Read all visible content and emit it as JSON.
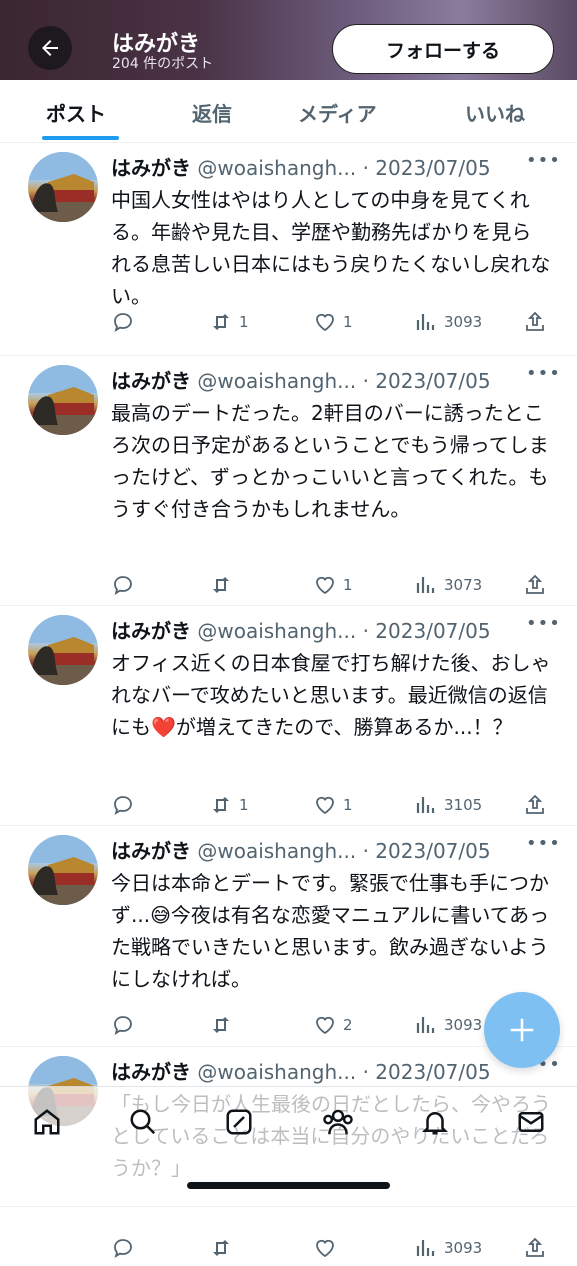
{
  "header": {
    "back_icon": "arrow-left-icon",
    "name": "はみがき",
    "post_count": "204 件のポスト",
    "follow_label": "フォローする"
  },
  "tabs": [
    "ポスト",
    "返信",
    "メディア",
    "いいね"
  ],
  "active_tab": 0,
  "posts": [
    {
      "name": "はみがき",
      "handle_date": "@woaishangh... · 2023/07/05",
      "text": "中国人女性はやはり人としての中身を見てくれる。年齢や見た目、学歴や勤務先ばかりを見られる息苦しい日本にはもう戻りたくないし戻れない。",
      "replies": "",
      "reposts": "1",
      "likes": "1",
      "views": "3093"
    },
    {
      "name": "はみがき",
      "handle_date": "@woaishangh... · 2023/07/05",
      "text": "最高のデートだった。2軒目のバーに誘ったところ次の日予定があるということでもう帰ってしまったけど、ずっとかっこいいと言ってくれた。もうすぐ付き合うかもしれません。",
      "replies": "",
      "reposts": "",
      "likes": "1",
      "views": "3073"
    },
    {
      "name": "はみがき",
      "handle_date": "@woaishangh... · 2023/07/05",
      "text": "オフィス近くの日本食屋で打ち解けた後、おしゃれなバーで攻めたいと思います。最近微信の返信にも❤️が増えてきたので、勝算あるか...！？",
      "replies": "",
      "reposts": "1",
      "likes": "1",
      "views": "3105"
    },
    {
      "name": "はみがき",
      "handle_date": "@woaishangh... · 2023/07/05",
      "text": "今日は本命とデートです。緊張で仕事も手につかず...😅今夜は有名な恋愛マニュアルに書いてあった戦略でいきたいと思います。飲み過ぎないようにしなければ。",
      "replies": "",
      "reposts": "",
      "likes": "2",
      "views": "3093"
    },
    {
      "name": "はみがき",
      "handle_date": "@woaishangh... · 2023/07/05",
      "text": "「もし今日が人生最後の日だとしたら、今やろうとしていることは本当に自分のやりたいことだろうか？」",
      "replies": "",
      "reposts": "",
      "likes": "",
      "views": "3093"
    }
  ],
  "fab": {
    "icon": "plus-icon"
  },
  "nav": [
    "home-icon",
    "search-icon",
    "grok-icon",
    "communities-icon",
    "notifications-icon",
    "messages-icon"
  ],
  "colors": {
    "accent": "#1d9bf0",
    "text": "#0f1419",
    "muted": "#536471"
  }
}
